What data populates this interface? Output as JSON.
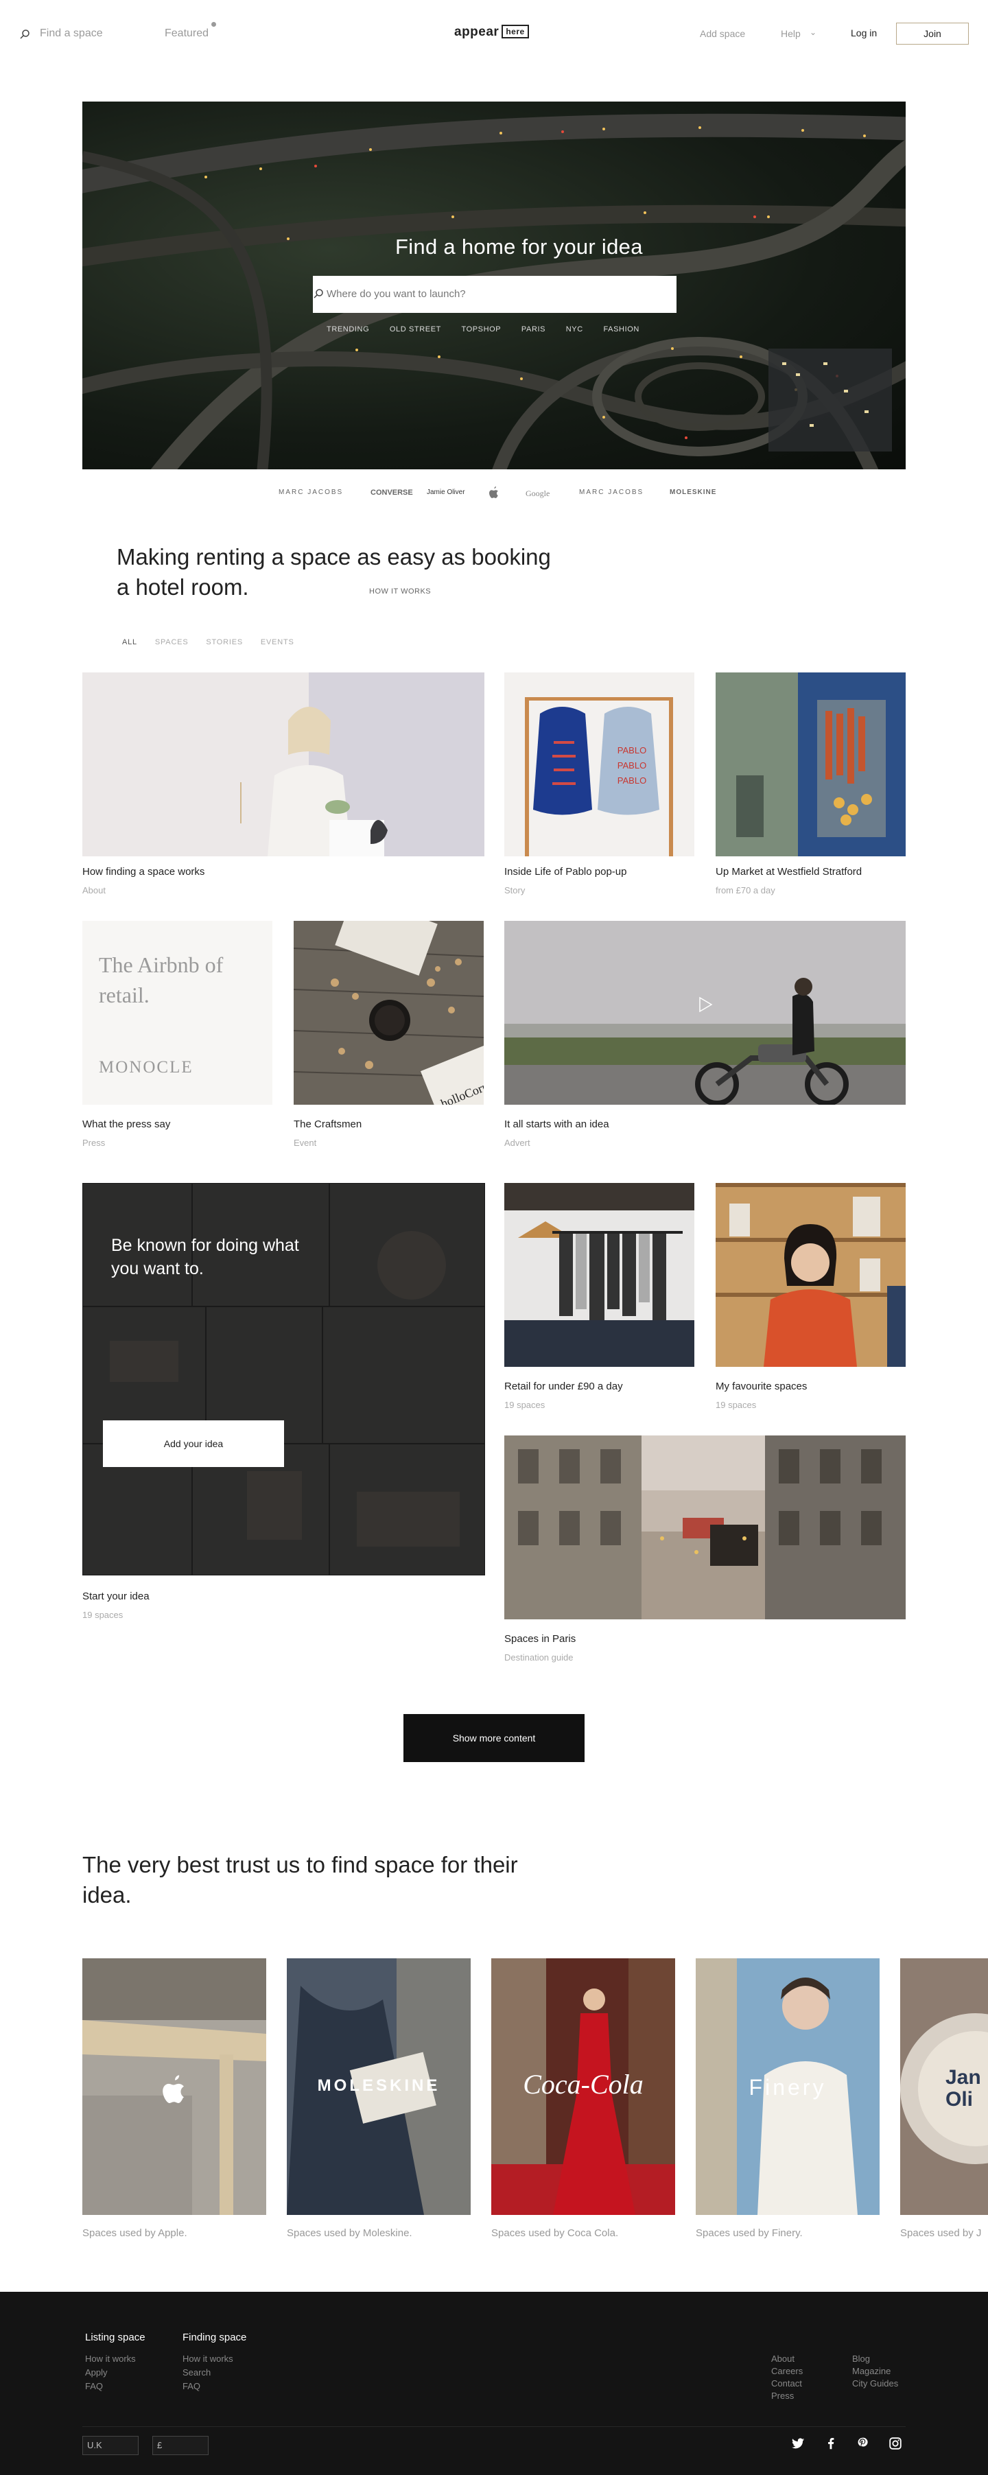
{
  "nav": {
    "find_label": "Find a space",
    "featured_label": "Featured",
    "logo_text": "appear",
    "logo_badge": "here",
    "add_space_label": "Add space",
    "help_label": "Help",
    "login_label": "Log in",
    "join_label": "Join"
  },
  "hero": {
    "title": "Find a home for your idea",
    "search_placeholder": "Where do you want to launch?",
    "tags": [
      "TRENDING",
      "OLD STREET",
      "TOPSHOP",
      "PARIS",
      "NYC",
      "FASHION"
    ]
  },
  "brands": [
    "MARC JACOBS",
    "CONVERSE",
    "Jamie Oliver",
    "apple-logo",
    "Google",
    "MARC JACOBS",
    "MOLESKINE"
  ],
  "tagline": {
    "text": "Making renting a space as easy as booking a hotel room.",
    "link": "HOW IT WORKS"
  },
  "filters": [
    "ALL",
    "SPACES",
    "STORIES",
    "EVENTS"
  ],
  "cards": [
    {
      "title": "How finding a space works",
      "sub": "About"
    },
    {
      "title": "Inside Life of Pablo pop-up",
      "sub": "Story"
    },
    {
      "title": "Up Market at Westfield Stratford",
      "sub": "from £70 a day"
    },
    {
      "title": "What the press say",
      "sub": "Press"
    },
    {
      "title": "The Craftsmen",
      "sub": "Event"
    },
    {
      "title": "It all starts with an idea",
      "sub": "Advert"
    },
    {
      "title": "Start your idea",
      "sub": "19 spaces"
    },
    {
      "title": "Retail for under £90 a day",
      "sub": "19 spaces"
    },
    {
      "title": "My favourite spaces",
      "sub": "19 spaces"
    },
    {
      "title": "Spaces in Paris",
      "sub": "Destination guide"
    }
  ],
  "press_card": {
    "quote": "The Airbnb of retail.",
    "source": "MONOCLE"
  },
  "hoodie_text": "PABLO",
  "book_text": "holloCorner",
  "cta": {
    "headline": "Be known for doing what you want to.",
    "button": "Add your idea"
  },
  "show_more": "Show more content",
  "trust": {
    "title": "The very best trust us to find space for their idea.",
    "brands": [
      {
        "logo": "apple-logo",
        "caption": "Spaces used by Apple."
      },
      {
        "logo": "MOLESKINE",
        "caption": "Spaces used by Moleskine."
      },
      {
        "logo": "Coca-Cola",
        "caption": "Spaces used by Coca Cola."
      },
      {
        "logo": "Finery",
        "caption": "Spaces used by Finery."
      },
      {
        "logo": "Jan Oli",
        "caption": "Spaces used by J"
      }
    ]
  },
  "footer": {
    "col1": {
      "title": "Listing space",
      "links": [
        "How it works",
        "Apply",
        "FAQ"
      ]
    },
    "col2": {
      "title": "Finding space",
      "links": [
        "How it works",
        "Search",
        "FAQ"
      ]
    },
    "col3": [
      "About",
      "Careers",
      "Contact",
      "Press"
    ],
    "col4": [
      "Blog",
      "Magazine",
      "City Guides"
    ],
    "country": "U.K",
    "currency": "£",
    "social": [
      "twitter-icon",
      "facebook-icon",
      "pinterest-icon",
      "instagram-icon"
    ]
  },
  "colors": {
    "accent_border": "#b8a88a",
    "footer_bg": "#141414",
    "button_bg": "#111111"
  }
}
